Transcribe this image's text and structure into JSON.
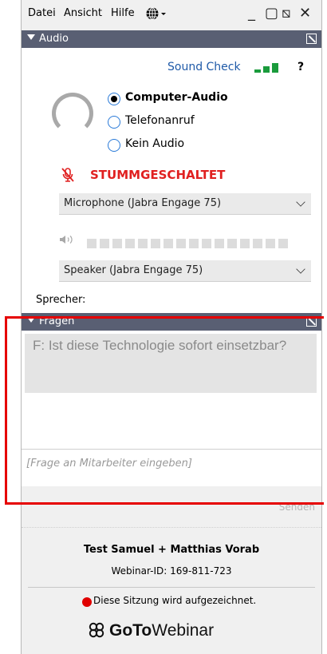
{
  "menu": {
    "file": "Datei",
    "view": "Ansicht",
    "help": "Hilfe"
  },
  "window": {
    "minimize": "_",
    "restore": "▢",
    "shrink": "⧅",
    "close": "✕"
  },
  "audio": {
    "section_title": "Audio",
    "sound_check": "Sound Check",
    "help": "?",
    "options": [
      "Computer-Audio",
      "Telefonanruf",
      "Kein Audio"
    ],
    "selected_option": "Computer-Audio",
    "mute_status": "STUMMGESCHALTET",
    "microphone": "Microphone (Jabra Engage 75)",
    "speaker": "Speaker (Jabra Engage 75)",
    "speaker_level": 0
  },
  "speaker_label": "Sprecher:",
  "questions": {
    "section_title": "Fragen",
    "question": "F: Ist diese Technologie sofort einsetzbar?",
    "input_placeholder": "[Frage an Mitarbeiter eingeben]",
    "send_label": "Senden"
  },
  "footer": {
    "organizer": "Test Samuel + Matthias Vorab",
    "webinar_id": "Webinar-ID: 169-811-723",
    "recording": "Diese Sitzung wird aufgezeichnet.",
    "logo_bold": "GoTo",
    "logo_regular": "Webinar"
  },
  "colors": {
    "section_bar": "#595f73",
    "mute": "#e02020",
    "link": "#1f5aa8",
    "signal": "#1a9b3c",
    "highlight": "#e60000"
  }
}
